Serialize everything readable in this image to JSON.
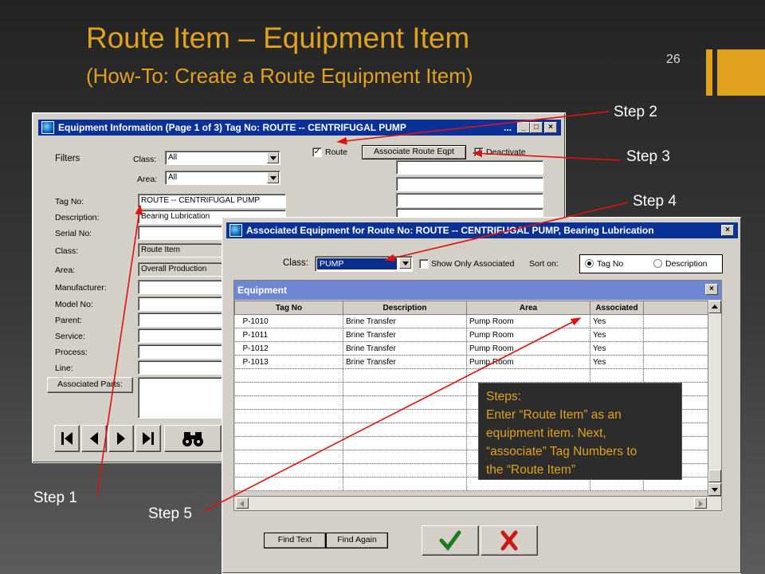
{
  "slide": {
    "title": "Route Item – Equipment Item",
    "subtitle": "(How-To:  Create a Route Equipment Item)",
    "page_number": "26",
    "accent_color": "#e0a21c"
  },
  "steps": {
    "step1": "Step 1",
    "step2": "Step 2",
    "step3": "Step 3",
    "step4": "Step 4",
    "step5": "Step 5"
  },
  "equipment_window": {
    "title": "Equipment Information (Page 1 of 3) Tag No: ROUTE -- CENTRIFUGAL PUMP",
    "title_ellipsis": "...",
    "filters_label": "Filters",
    "class_label": "Class:",
    "class_value": "All",
    "area_label": "Area:",
    "area_value": "All",
    "route_label": "Route",
    "route_checked": true,
    "associate_button": "Associate Route Eqpt",
    "deactivate_label": "Deactivate",
    "fields": {
      "tag_no_label": "Tag No:",
      "tag_no_value": "ROUTE -- CENTRIFUGAL PUMP",
      "description_label": "Description:",
      "description_value": "Bearing Lubrication",
      "serial_no_label": "Serial No:",
      "class_label": "Class:",
      "class_value": "Route Item",
      "area_label": "Area:",
      "area_value": "Overall Production",
      "manufacturer_label": "Manufacturer:",
      "model_no_label": "Model No:",
      "parent_label": "Parent:",
      "service_label": "Service:",
      "process_label": "Process:",
      "line_label": "Line:"
    },
    "associated_parts_button": "Associated Parts:"
  },
  "assoc_window": {
    "title": "Associated Equipment for Route No: ROUTE -- CENTRIFUGAL PUMP, Bearing Lubrication",
    "class_label": "Class:",
    "class_value": "PUMP",
    "show_only_associated_label": "Show Only Associated",
    "sort_on_label": "Sort on:",
    "sort_options": [
      "Tag No",
      "Description"
    ],
    "sort_selected": "Tag No",
    "grid_title": "Equipment",
    "columns": [
      "Tag No",
      "Description",
      "Area",
      "Associated"
    ],
    "rows": [
      [
        "P-1010",
        "Brine Transfer",
        "Pump Room",
        "Yes"
      ],
      [
        "P-1011",
        "Brine Transfer",
        "Pump Room",
        "Yes"
      ],
      [
        "P-1012",
        "Brine Transfer",
        "Pump Room",
        "Yes"
      ],
      [
        "P-1013",
        "Brine Transfer",
        "Pump Room",
        "Yes"
      ]
    ],
    "find_text_button": "Find Text",
    "find_again_button": "Find Again"
  },
  "note": {
    "lines": [
      "Steps:",
      "Enter “Route Item” as an",
      "equipment item.  Next,",
      "“associate” Tag Numbers to",
      "the “Route Item”"
    ]
  }
}
